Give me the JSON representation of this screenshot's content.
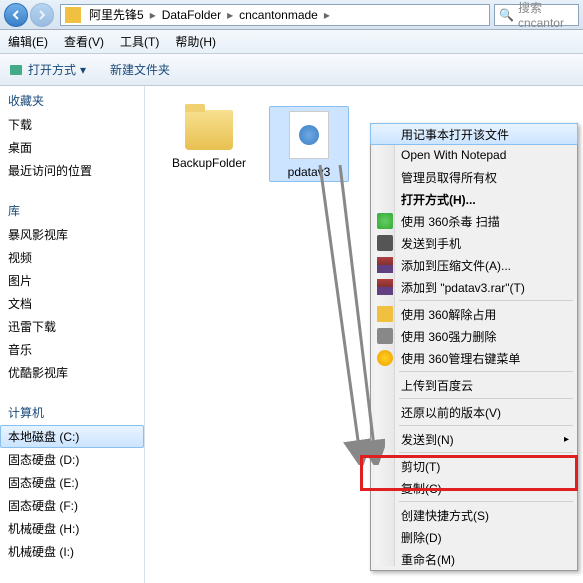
{
  "breadcrumb": {
    "items": [
      "阿里先锋5",
      "DataFolder",
      "cncantonmade"
    ]
  },
  "search": {
    "placeholder": "搜索 cncantor"
  },
  "menubar": {
    "edit": "编辑(E)",
    "view": "查看(V)",
    "tools": "工具(T)",
    "help": "帮助(H)"
  },
  "toolbar": {
    "open_with": "打开方式",
    "new_folder": "新建文件夹"
  },
  "sidebar": {
    "favorites": {
      "title": "收藏夹",
      "items": [
        "下载",
        "桌面",
        "最近访问的位置"
      ]
    },
    "libraries": {
      "title": "库",
      "items": [
        "暴风影视库",
        "视频",
        "图片",
        "文档",
        "迅雷下载",
        "音乐",
        "优酷影视库"
      ]
    },
    "computer": {
      "title": "计算机",
      "items": [
        "本地磁盘 (C:)",
        "固态硬盘 (D:)",
        "固态硬盘 (E:)",
        "固态硬盘 (F:)",
        "机械硬盘 (H:)",
        "机械硬盘 (I:)"
      ]
    }
  },
  "files": {
    "folder": "BackupFolder",
    "file": "pdatav3"
  },
  "ctx": {
    "open_notepad_cn": "用记事本打开该文件",
    "open_notepad_en": "Open With Notepad",
    "admin_owner": "管理员取得所有权",
    "open_with": "打开方式(H)...",
    "scan_360": "使用 360杀毒 扫描",
    "send_phone": "发送到手机",
    "add_archive": "添加到压缩文件(A)...",
    "add_rar": "添加到 \"pdatav3.rar\"(T)",
    "unlock_360": "使用 360解除占用",
    "force_del_360": "使用 360强力删除",
    "manage_menu_360": "使用 360管理右键菜单",
    "upload_baidu": "上传到百度云",
    "restore_version": "还原以前的版本(V)",
    "send_to": "发送到(N)",
    "cut": "剪切(T)",
    "copy": "复制(C)",
    "create_shortcut": "创建快捷方式(S)",
    "delete": "删除(D)",
    "rename": "重命名(M)"
  }
}
